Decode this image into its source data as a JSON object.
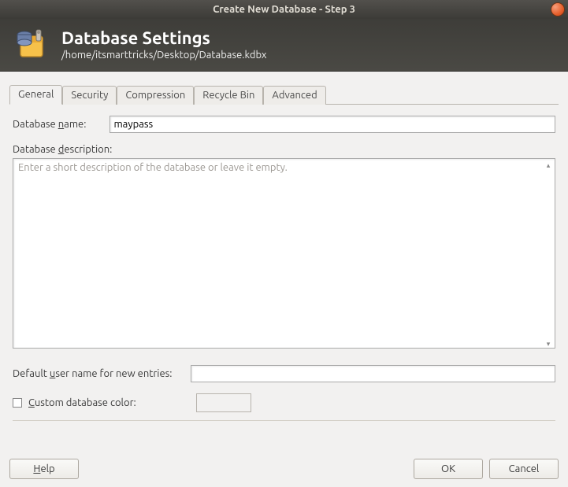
{
  "window": {
    "title": "Create New Database - Step 3"
  },
  "header": {
    "title": "Database Settings",
    "path": "/home/itsmarttricks/Desktop/Database.kdbx"
  },
  "tabs": {
    "general": "General",
    "security": "Security",
    "compression": "Compression",
    "recycle": "Recycle Bin",
    "advanced": "Advanced"
  },
  "form": {
    "name_label_pre": "Database ",
    "name_label_u": "n",
    "name_label_post": "ame:",
    "name_value": "maypass",
    "desc_label_pre": "Database ",
    "desc_label_u": "d",
    "desc_label_post": "escription:",
    "desc_placeholder": "Enter a short description of the database or leave it empty.",
    "default_user_pre": "Default ",
    "default_user_u": "u",
    "default_user_post": "ser name for new entries:",
    "default_user_value": "",
    "custom_color_u": "C",
    "custom_color_post": "ustom database color:"
  },
  "buttons": {
    "help_u": "H",
    "help_post": "elp",
    "ok": "OK",
    "cancel": "Cancel"
  }
}
